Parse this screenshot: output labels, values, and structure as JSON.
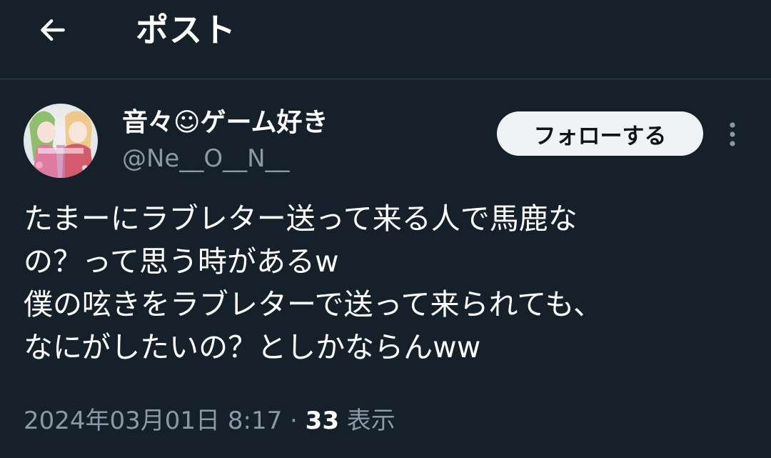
{
  "header": {
    "title": "ポスト",
    "back_icon": "arrow-left-icon"
  },
  "author": {
    "display_name": "音々☺ゲーム好き",
    "handle": "@Ne__O__N__",
    "avatar_icon": "avatar-image"
  },
  "follow_button": {
    "label": "フォローする"
  },
  "more_icon": "more-vertical-icon",
  "tweet": {
    "lines": [
      "たまーにラブレター送って来る人で馬鹿な",
      "の？って思う時があるw",
      "僕の呟きをラブレターで送って来られても、",
      "なにがしたいの？としかならんww"
    ]
  },
  "meta": {
    "timestamp": "2024年03月01日 8:17",
    "separator": " · ",
    "views_count": "33",
    "views_label": " 表示"
  },
  "colors": {
    "background": "#15202b",
    "text": "#ffffff",
    "secondary_text": "#8b98a5",
    "divider": "#38444d",
    "button_bg": "#eff3f4",
    "button_text": "#0f1419"
  }
}
